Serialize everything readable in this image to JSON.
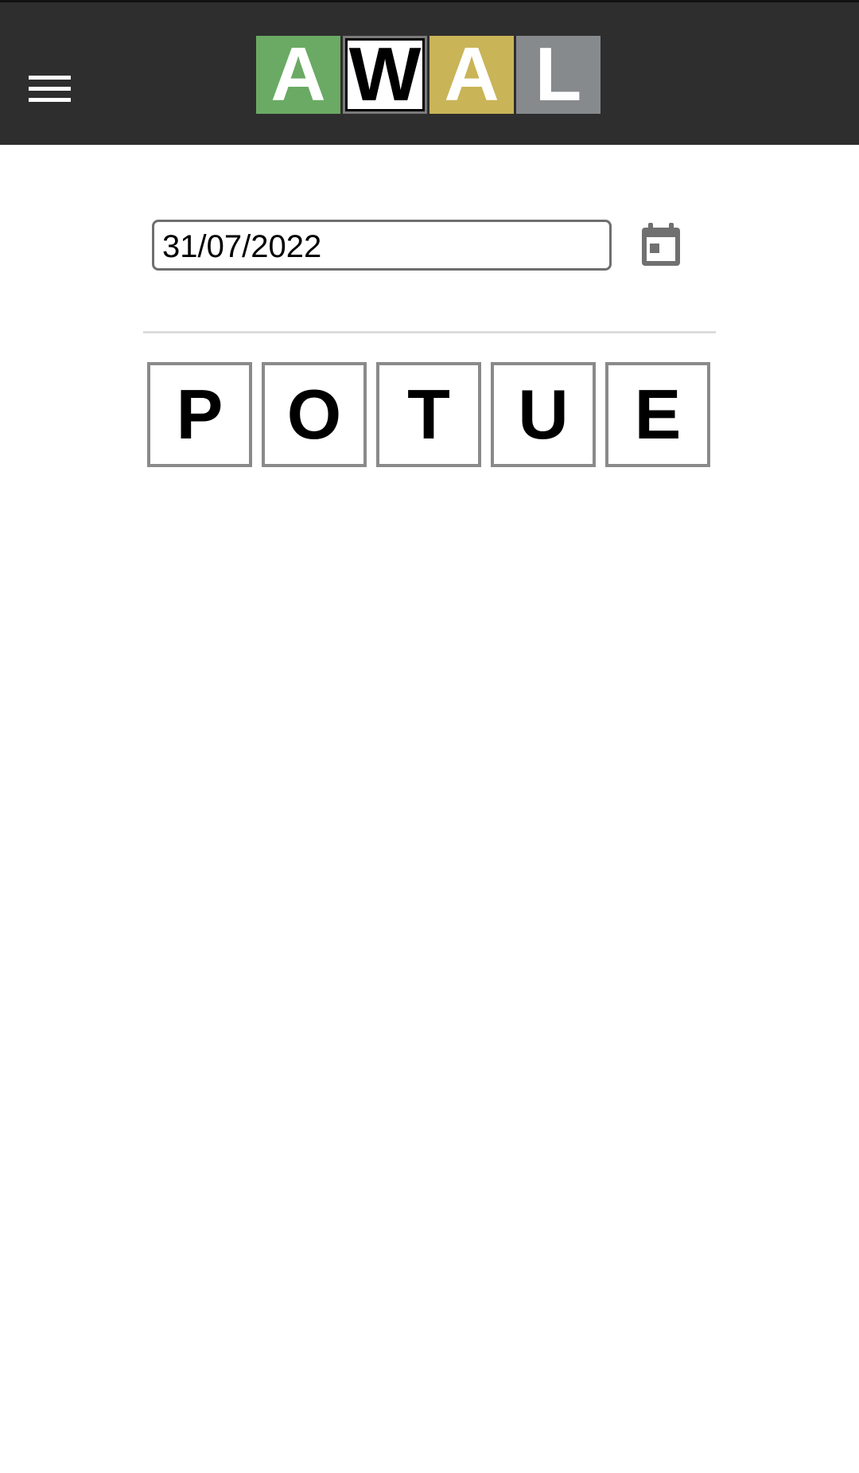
{
  "header": {
    "logo_letters": [
      "A",
      "W",
      "A",
      "L"
    ],
    "logo_colors": [
      "#6aaa64",
      "#ffffff",
      "#c9b458",
      "#878a8c"
    ],
    "background": "#2e2e2e"
  },
  "date_picker": {
    "value": "31/07/2022",
    "icon": "calendar-icon"
  },
  "word": {
    "letters": [
      "P",
      "O",
      "T",
      "U",
      "E"
    ]
  }
}
